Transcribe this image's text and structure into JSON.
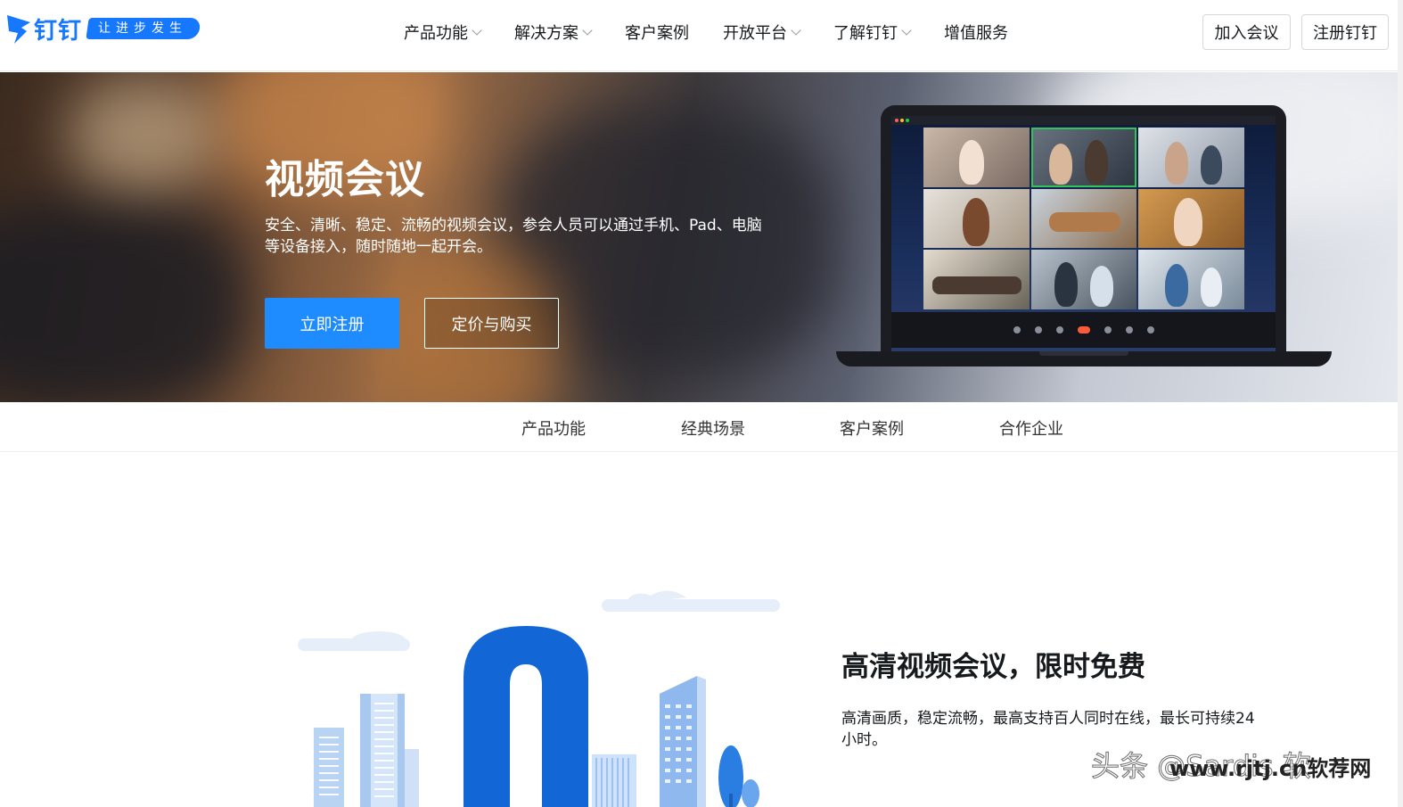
{
  "brand": {
    "logo_text": "钉钉",
    "slogan": "让进步发生"
  },
  "nav": {
    "items": [
      {
        "label": "产品功能",
        "dropdown": true
      },
      {
        "label": "解决方案",
        "dropdown": true
      },
      {
        "label": "客户案例",
        "dropdown": false
      },
      {
        "label": "开放平台",
        "dropdown": true
      },
      {
        "label": "了解钉钉",
        "dropdown": true
      },
      {
        "label": "增值服务",
        "dropdown": false
      }
    ],
    "join_label": "加入会议",
    "register_label": "注册钉钉"
  },
  "hero": {
    "title": "视频会议",
    "description": "安全、清晰、稳定、流畅的视频会议，参会人员可以通过手机、Pad、电脑等设备接入，随时随地一起开会。",
    "primary_label": "立即注册",
    "secondary_label": "定价与购买"
  },
  "subnav": {
    "items": [
      "产品功能",
      "经典场景",
      "客户案例",
      "合作企业"
    ]
  },
  "feature": {
    "title": "高清视频会议，限时免费",
    "description": "高清画质，稳定流畅，最高支持百人同时在线，最长可持续24小时。"
  },
  "watermark": {
    "text": "头条 @Sardis 软",
    "site": "www.rjtj.cn软荐网"
  },
  "colors": {
    "brand_blue": "#1677ff",
    "primary_button": "#1e8cff",
    "end_call": "#ff5b3b"
  }
}
